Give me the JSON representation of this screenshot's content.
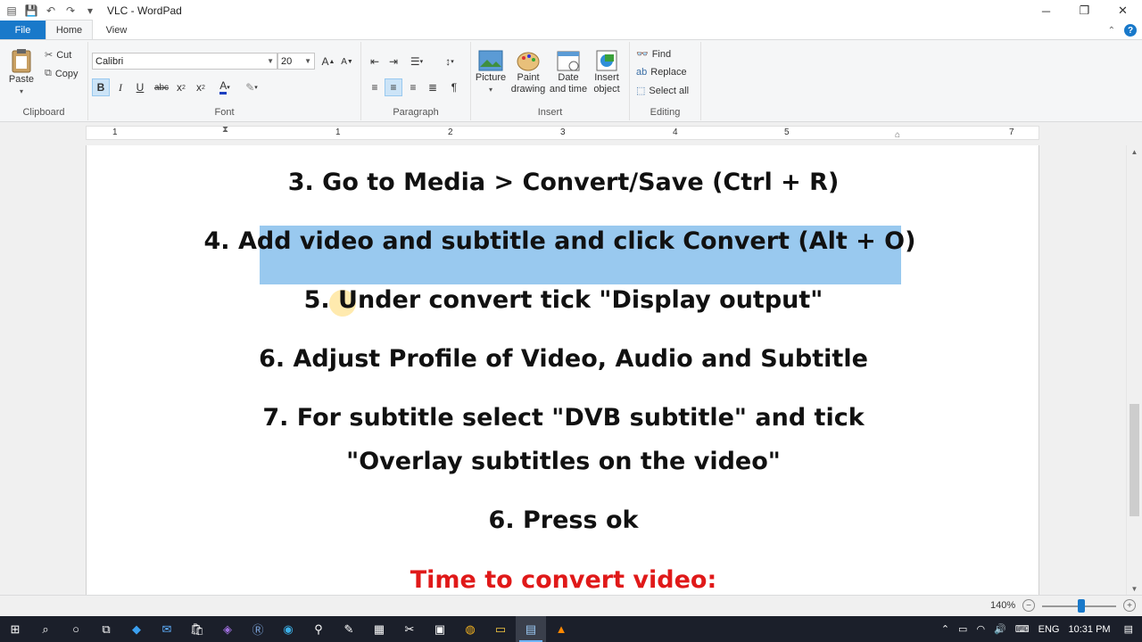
{
  "window": {
    "title": "VLC - WordPad"
  },
  "tabs": {
    "file": "File",
    "home": "Home",
    "view": "View"
  },
  "clipboard": {
    "paste": "Paste",
    "cut": "Cut",
    "copy": "Copy",
    "label": "Clipboard"
  },
  "font": {
    "family": "Calibri",
    "size": "20",
    "label": "Font",
    "bold": "B",
    "italic": "I",
    "underline": "U",
    "strike": "abc"
  },
  "paragraph": {
    "label": "Paragraph"
  },
  "insert": {
    "picture": "Picture",
    "paint": "Paint drawing",
    "datetime": "Date and time",
    "object": "Insert object",
    "label": "Insert"
  },
  "editing": {
    "find": "Find",
    "replace": "Replace",
    "selectall": "Select all",
    "label": "Editing"
  },
  "ruler": {
    "numbers": [
      "1",
      "1",
      "2",
      "3",
      "4",
      "5",
      "7"
    ]
  },
  "document": {
    "lines": [
      "3. Go to Media > Convert/Save (Ctrl + R)",
      "4.",
      "Add video and subtitle and click Convert (Alt + O)",
      "5. Under convert tick \"Display output\"",
      "6. Adjust Profile of Video, Audio and Subtitle",
      "7. For subtitle select \"DVB subtitle\" and tick",
      "\"Overlay subtitles on the video\"",
      "6. Press ok",
      "Time to convert video:"
    ]
  },
  "status": {
    "zoom": "140%"
  },
  "tray": {
    "lang": "ENG",
    "time": "10:31 PM"
  }
}
